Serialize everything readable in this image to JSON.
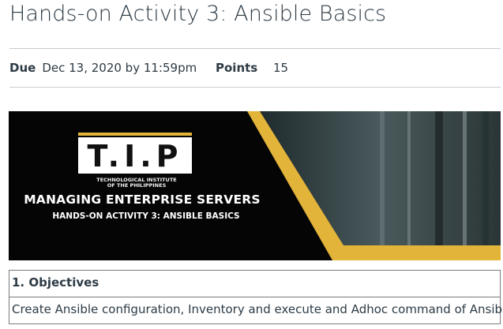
{
  "page": {
    "title": "Hands-on Activity 3: Ansible Basics"
  },
  "meta": {
    "due_label": "Due",
    "due_value": "Dec 13, 2020 by 11:59pm",
    "points_label": "Points",
    "points_value": "15"
  },
  "banner": {
    "logo_text": "T.I.P",
    "logo_subtitle_line1": "TECHNOLOGICAL INSTITUTE",
    "logo_subtitle_line2": "OF THE PHILIPPINES",
    "title": "MANAGING ENTERPRISE SERVERS",
    "subtitle": "HANDS-ON ACTIVITY 3: ANSIBLE BASICS",
    "accent_color": "#e3b43a"
  },
  "objectives": {
    "heading": "1. Objectives",
    "text": "Create Ansible configuration, Inventory and execute and Adhoc command of Ansible."
  }
}
